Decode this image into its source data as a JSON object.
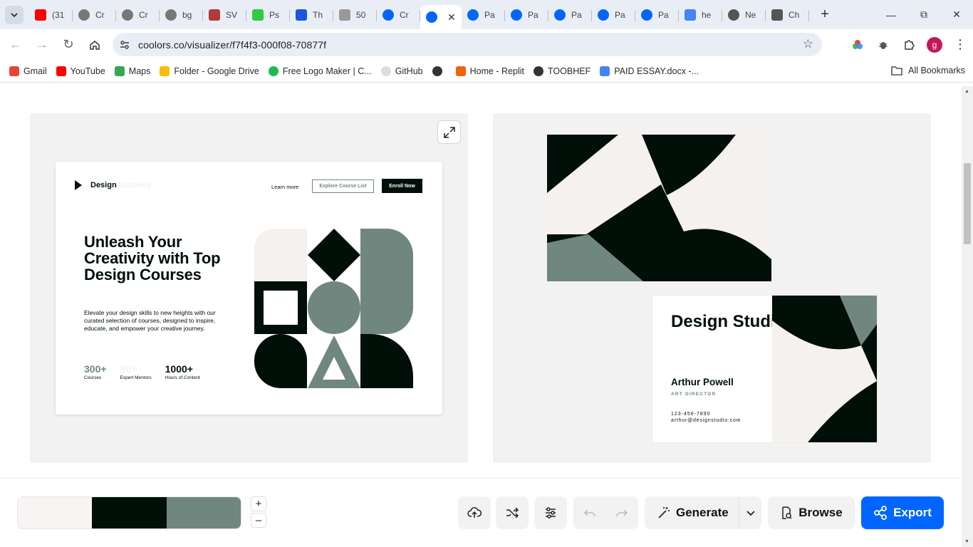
{
  "browser": {
    "tabs": [
      {
        "label": "(31",
        "icon": "youtube-icon",
        "color": "#ff0000"
      },
      {
        "label": "Cr",
        "icon": "globe-icon",
        "color": "#777777"
      },
      {
        "label": "Cr",
        "icon": "globe-icon",
        "color": "#777777"
      },
      {
        "label": "bg",
        "icon": "globe-icon",
        "color": "#777777"
      },
      {
        "label": "SV",
        "icon": "cloud-icon",
        "color": "#b33a3a"
      },
      {
        "label": "Ps",
        "icon": "zapier-icon",
        "color": "#2ecc40"
      },
      {
        "label": "Th",
        "icon": "w-icon",
        "color": "#1a56db"
      },
      {
        "label": "50",
        "icon": "doc-icon",
        "color": "#999999"
      },
      {
        "label": "Cr",
        "icon": "coolors-icon",
        "color": "#0066ff"
      },
      {
        "label": "",
        "icon": "coolors-icon",
        "color": "#0066ff",
        "active": true
      },
      {
        "label": "Pa",
        "icon": "coolors-icon",
        "color": "#0066ff"
      },
      {
        "label": "Pa",
        "icon": "coolors-icon",
        "color": "#0066ff"
      },
      {
        "label": "Pa",
        "icon": "coolors-icon",
        "color": "#0066ff"
      },
      {
        "label": "Pa",
        "icon": "coolors-icon",
        "color": "#0066ff"
      },
      {
        "label": "Pa",
        "icon": "coolors-icon",
        "color": "#0066ff"
      },
      {
        "label": "he",
        "icon": "google-icon",
        "color": "#4285f4"
      },
      {
        "label": "Ne",
        "icon": "globe-icon",
        "color": "#555555"
      },
      {
        "label": "Ch",
        "icon": "openai-icon",
        "color": "#555555"
      }
    ],
    "url": "coolors.co/visualizer/f7f4f3-000f08-70877f",
    "bookmarks": [
      {
        "label": "Gmail",
        "icon": "gmail-icon"
      },
      {
        "label": "YouTube",
        "icon": "youtube-icon"
      },
      {
        "label": "Maps",
        "icon": "maps-icon"
      },
      {
        "label": "Folder - Google Drive",
        "icon": "drive-icon"
      },
      {
        "label": "Free Logo Maker | C...",
        "icon": "logo-maker-icon"
      },
      {
        "label": "GitHub",
        "icon": "github-icon"
      },
      {
        "label": "",
        "icon": "globe-icon"
      },
      {
        "label": "Home - Replit",
        "icon": "replit-icon"
      },
      {
        "label": "TOOBHEF",
        "icon": "globe-icon"
      },
      {
        "label": "PAID ESSAY.docx -...",
        "icon": "docs-icon"
      }
    ],
    "all_bookmarks": "All Bookmarks",
    "profile_initial": "g"
  },
  "website": {
    "logo_bold": "Design",
    "logo_light": "Academy",
    "nav_learn": "Learn more",
    "nav_explore": "Explore Course List",
    "nav_enroll": "Enroll Now",
    "headline": "Unleash Your Creativity with Top Design Courses",
    "paragraph": "Elevate your design skills to new heights with our curated selection of courses, designed to inspire, educate, and empower your creative journey.",
    "stats": [
      {
        "number": "300+",
        "label": "Courses",
        "color": "#70877f"
      },
      {
        "number": "50+",
        "label": "Expert Mentors",
        "color": "#f4f1ef"
      },
      {
        "number": "1000+",
        "label": "Hours of Content",
        "color": "#000f08"
      }
    ]
  },
  "business_card": {
    "title": "Design Studio",
    "person": "Arthur Powell",
    "role": "ART DIRECTOR",
    "phone": "123-456-7890",
    "email": "arthur@designstudio.com"
  },
  "palette": {
    "colors": [
      "#f7f4f3",
      "#000f08",
      "#70877f"
    ]
  },
  "actions": {
    "generate": "Generate",
    "browse": "Browse",
    "export": "Export"
  },
  "colors": {
    "dark": "#000f08",
    "sage": "#70877f",
    "light": "#f4f1ef",
    "accent": "#0066ff"
  }
}
